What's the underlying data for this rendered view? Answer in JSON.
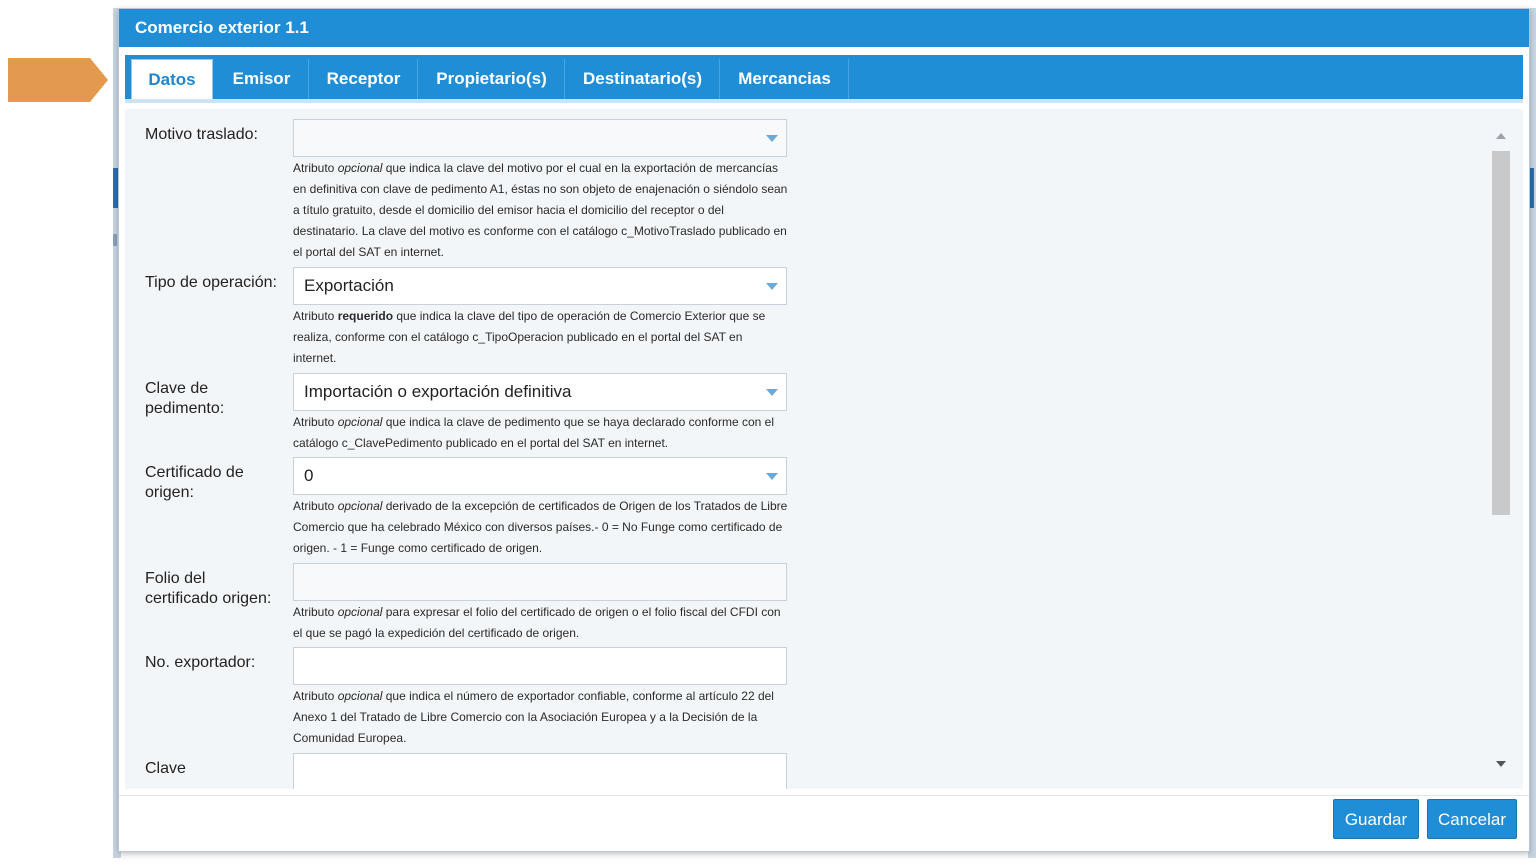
{
  "dialog": {
    "title": "Comercio exterior 1.1"
  },
  "tabs": [
    {
      "label": "Datos",
      "active": true
    },
    {
      "label": "Emisor"
    },
    {
      "label": "Receptor"
    },
    {
      "label": "Propietario(s)"
    },
    {
      "label": "Destinatario(s)"
    },
    {
      "label": "Mercancias"
    }
  ],
  "fields": {
    "motivo_traslado": {
      "label": "Motivo traslado:",
      "value": "",
      "help_pre": "Atributo ",
      "help_em": "opcional",
      "help_post": " que indica la clave del motivo por el cual en la exportación de mercancías en definitiva con clave de pedimento A1, éstas no son objeto de enajenación o siéndolo sean a título gratuito, desde el domicilio del emisor hacia el domicilio del receptor o del destinatario. La clave del motivo es conforme con el catálogo c_MotivoTraslado publicado en el portal del SAT en internet."
    },
    "tipo_operacion": {
      "label": "Tipo de operación:",
      "value": "Exportación",
      "help_pre": "Atributo ",
      "help_em": "requerido",
      "help_post": " que indica la clave del tipo de operación de Comercio Exterior que se realiza, conforme con el catálogo c_TipoOperacion publicado en el portal del SAT en internet."
    },
    "clave_pedimento": {
      "label_line1": "Clave de",
      "label_line2": "pedimento:",
      "value": "Importación o exportación definitiva",
      "help_pre": "Atributo ",
      "help_em": "opcional",
      "help_post": " que indica la clave de pedimento que se haya declarado conforme con el catálogo c_ClavePedimento publicado en el portal del SAT en internet."
    },
    "certificado_origen": {
      "label_line1": "Certificado de",
      "label_line2": "origen:",
      "value": "0",
      "help_pre": "Atributo ",
      "help_em": "opcional",
      "help_post": " derivado de la excepción de certificados de Origen de los Tratados de Libre Comercio que ha celebrado México con diversos países.- 0 = No Funge como certificado de origen. - 1 = Funge como certificado de origen."
    },
    "folio_certificado": {
      "label_line1": "Folio del",
      "label_line2": "certificado origen:",
      "value": "",
      "help_pre": "Atributo ",
      "help_em": "opcional",
      "help_post": " para expresar el folio del certificado de origen o el folio fiscal del CFDI con el que se pagó la expedición del certificado de origen."
    },
    "no_exportador": {
      "label": "No. exportador:",
      "value": "",
      "help_pre": "Atributo ",
      "help_em": "opcional",
      "help_post": " que indica el número de exportador confiable, conforme al artículo 22 del Anexo 1 del Tratado de Libre Comercio con la Asociación Europea y a la Decisión de la Comunidad Europea."
    },
    "clave_next": {
      "label": "Clave"
    }
  },
  "buttons": {
    "save": "Guardar",
    "cancel": "Cancelar"
  },
  "colors": {
    "primary": "#1f8ed6",
    "arrow": "#e39a4f"
  }
}
